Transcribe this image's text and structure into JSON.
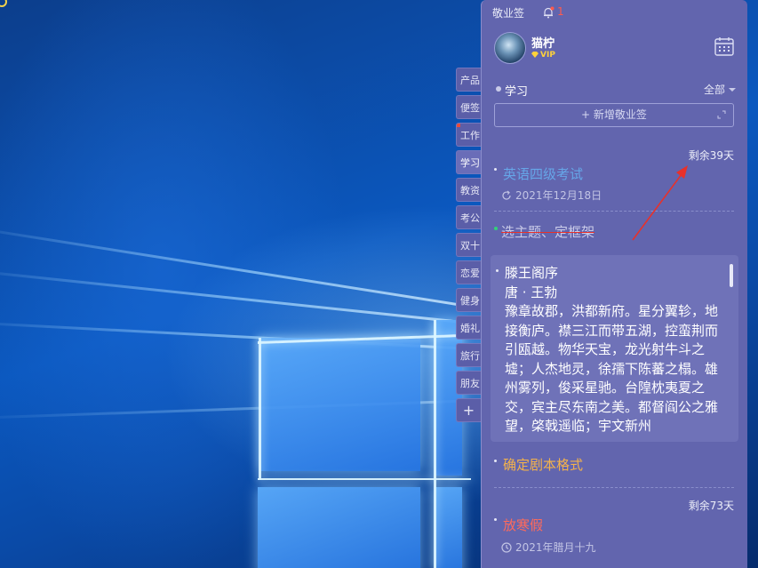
{
  "app": {
    "title": "敬业签",
    "notification_count": "1",
    "icons": [
      "cloud-sync-icon",
      "menu-icon",
      "collapse-icon"
    ]
  },
  "user": {
    "name": "猫柠",
    "badge": "VIP"
  },
  "category": {
    "current": "学习",
    "filter": "全部"
  },
  "add_button": {
    "label": "新增敬业签"
  },
  "tabs": [
    {
      "label": "产品"
    },
    {
      "label": "便签"
    },
    {
      "label": "工作"
    },
    {
      "label": "学习"
    },
    {
      "label": "教资"
    },
    {
      "label": "考公"
    },
    {
      "label": "双十"
    },
    {
      "label": "恋爱"
    },
    {
      "label": "健身"
    },
    {
      "label": "婚礼"
    },
    {
      "label": "旅行"
    },
    {
      "label": "朋友"
    },
    {
      "label": "+"
    }
  ],
  "notes": [
    {
      "remaining": "剩余39天",
      "title": "英语四级考试",
      "date": "2021年12月18日",
      "title_color": "#66a6e8"
    },
    {
      "title": "选主题、定框架",
      "title_color": "#c9cbe8"
    },
    {
      "title": "滕王阁序",
      "body": "滕王阁序\n唐 · 王勃\n豫章故郡，洪都新府。星分翼轸，地接衡庐。襟三江而带五湖，控蛮荆而引瓯越。物华天宝，龙光射牛斗之墟；人杰地灵，徐孺下陈蕃之榻。雄州雾列，俊采星驰。台隍枕夷夏之交，宾主尽东南之美。都督阎公之雅望，棨戟遥临；宇文新州"
    },
    {
      "title": "确定剧本格式",
      "title_color": "#f3b24c"
    },
    {
      "remaining": "剩余73天",
      "title": "放寒假",
      "date": "2021年腊月十九",
      "title_color": "#ff6a5b"
    }
  ],
  "colors": {
    "panel_bg": "#6265ae",
    "accent_red": "#e8312a"
  }
}
